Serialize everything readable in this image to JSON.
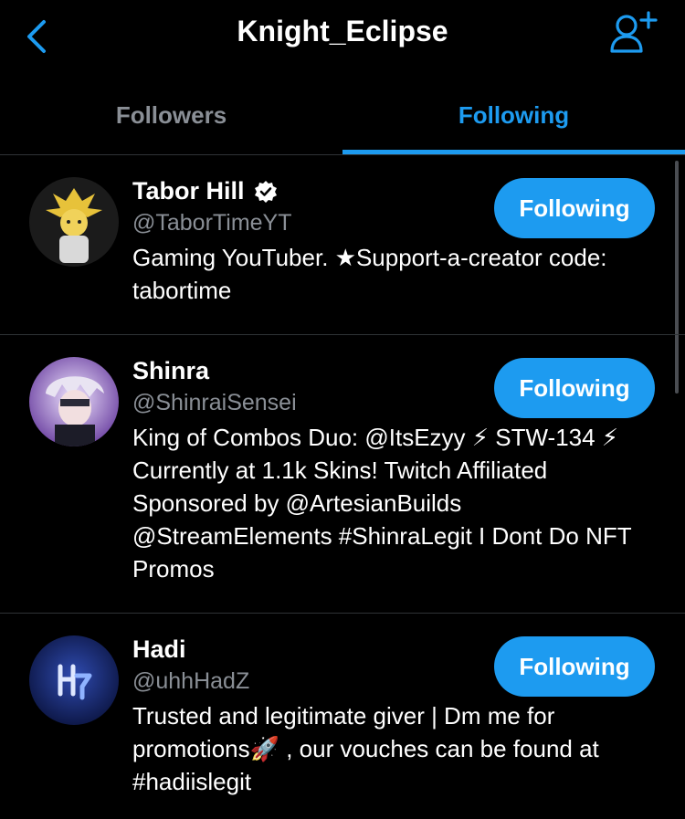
{
  "header": {
    "title": "Knight_Eclipse"
  },
  "tabs": [
    {
      "label": "Followers",
      "active": false
    },
    {
      "label": "Following",
      "active": true
    }
  ],
  "users": [
    {
      "name": "Tabor Hill",
      "verified": true,
      "handle": "@TaborTimeYT",
      "bio": "Gaming YouTuber. ★Support-a-creator code: tabortime",
      "button_label": "Following"
    },
    {
      "name": "Shinra",
      "verified": false,
      "handle": "@ShinraiSensei",
      "bio": "King of Combos Duo: @ItsEzyy ⚡ STW-134 ⚡ Currently at 1.1k Skins! Twitch Affiliated Sponsored by @ArtesianBuilds @StreamElements #ShinraLegit I Dont Do NFT Promos",
      "button_label": "Following"
    },
    {
      "name": "Hadi",
      "verified": false,
      "handle": "@uhhHadZ",
      "bio": "Trusted and legitimate giver | Dm me for promotions🚀 , our vouches can be found at #hadiislegit",
      "button_label": "Following"
    }
  ],
  "colors": {
    "accent": "#1d9bf0",
    "background": "#000000",
    "muted": "#8a8f96"
  },
  "icons": {
    "back": "chevron-left-icon",
    "add_user": "add-user-icon",
    "verified": "verified-badge-icon"
  }
}
